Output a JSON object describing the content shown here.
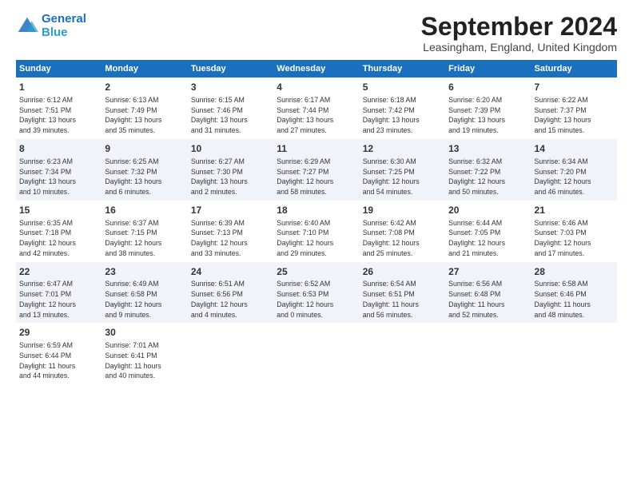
{
  "header": {
    "logo_line1": "General",
    "logo_line2": "Blue",
    "title": "September 2024",
    "location": "Leasingham, England, United Kingdom"
  },
  "columns": [
    "Sunday",
    "Monday",
    "Tuesday",
    "Wednesday",
    "Thursday",
    "Friday",
    "Saturday"
  ],
  "weeks": [
    [
      {
        "day": "1",
        "info": "Sunrise: 6:12 AM\nSunset: 7:51 PM\nDaylight: 13 hours\nand 39 minutes."
      },
      {
        "day": "2",
        "info": "Sunrise: 6:13 AM\nSunset: 7:49 PM\nDaylight: 13 hours\nand 35 minutes."
      },
      {
        "day": "3",
        "info": "Sunrise: 6:15 AM\nSunset: 7:46 PM\nDaylight: 13 hours\nand 31 minutes."
      },
      {
        "day": "4",
        "info": "Sunrise: 6:17 AM\nSunset: 7:44 PM\nDaylight: 13 hours\nand 27 minutes."
      },
      {
        "day": "5",
        "info": "Sunrise: 6:18 AM\nSunset: 7:42 PM\nDaylight: 13 hours\nand 23 minutes."
      },
      {
        "day": "6",
        "info": "Sunrise: 6:20 AM\nSunset: 7:39 PM\nDaylight: 13 hours\nand 19 minutes."
      },
      {
        "day": "7",
        "info": "Sunrise: 6:22 AM\nSunset: 7:37 PM\nDaylight: 13 hours\nand 15 minutes."
      }
    ],
    [
      {
        "day": "8",
        "info": "Sunrise: 6:23 AM\nSunset: 7:34 PM\nDaylight: 13 hours\nand 10 minutes."
      },
      {
        "day": "9",
        "info": "Sunrise: 6:25 AM\nSunset: 7:32 PM\nDaylight: 13 hours\nand 6 minutes."
      },
      {
        "day": "10",
        "info": "Sunrise: 6:27 AM\nSunset: 7:30 PM\nDaylight: 13 hours\nand 2 minutes."
      },
      {
        "day": "11",
        "info": "Sunrise: 6:29 AM\nSunset: 7:27 PM\nDaylight: 12 hours\nand 58 minutes."
      },
      {
        "day": "12",
        "info": "Sunrise: 6:30 AM\nSunset: 7:25 PM\nDaylight: 12 hours\nand 54 minutes."
      },
      {
        "day": "13",
        "info": "Sunrise: 6:32 AM\nSunset: 7:22 PM\nDaylight: 12 hours\nand 50 minutes."
      },
      {
        "day": "14",
        "info": "Sunrise: 6:34 AM\nSunset: 7:20 PM\nDaylight: 12 hours\nand 46 minutes."
      }
    ],
    [
      {
        "day": "15",
        "info": "Sunrise: 6:35 AM\nSunset: 7:18 PM\nDaylight: 12 hours\nand 42 minutes."
      },
      {
        "day": "16",
        "info": "Sunrise: 6:37 AM\nSunset: 7:15 PM\nDaylight: 12 hours\nand 38 minutes."
      },
      {
        "day": "17",
        "info": "Sunrise: 6:39 AM\nSunset: 7:13 PM\nDaylight: 12 hours\nand 33 minutes."
      },
      {
        "day": "18",
        "info": "Sunrise: 6:40 AM\nSunset: 7:10 PM\nDaylight: 12 hours\nand 29 minutes."
      },
      {
        "day": "19",
        "info": "Sunrise: 6:42 AM\nSunset: 7:08 PM\nDaylight: 12 hours\nand 25 minutes."
      },
      {
        "day": "20",
        "info": "Sunrise: 6:44 AM\nSunset: 7:05 PM\nDaylight: 12 hours\nand 21 minutes."
      },
      {
        "day": "21",
        "info": "Sunrise: 6:46 AM\nSunset: 7:03 PM\nDaylight: 12 hours\nand 17 minutes."
      }
    ],
    [
      {
        "day": "22",
        "info": "Sunrise: 6:47 AM\nSunset: 7:01 PM\nDaylight: 12 hours\nand 13 minutes."
      },
      {
        "day": "23",
        "info": "Sunrise: 6:49 AM\nSunset: 6:58 PM\nDaylight: 12 hours\nand 9 minutes."
      },
      {
        "day": "24",
        "info": "Sunrise: 6:51 AM\nSunset: 6:56 PM\nDaylight: 12 hours\nand 4 minutes."
      },
      {
        "day": "25",
        "info": "Sunrise: 6:52 AM\nSunset: 6:53 PM\nDaylight: 12 hours\nand 0 minutes."
      },
      {
        "day": "26",
        "info": "Sunrise: 6:54 AM\nSunset: 6:51 PM\nDaylight: 11 hours\nand 56 minutes."
      },
      {
        "day": "27",
        "info": "Sunrise: 6:56 AM\nSunset: 6:48 PM\nDaylight: 11 hours\nand 52 minutes."
      },
      {
        "day": "28",
        "info": "Sunrise: 6:58 AM\nSunset: 6:46 PM\nDaylight: 11 hours\nand 48 minutes."
      }
    ],
    [
      {
        "day": "29",
        "info": "Sunrise: 6:59 AM\nSunset: 6:44 PM\nDaylight: 11 hours\nand 44 minutes."
      },
      {
        "day": "30",
        "info": "Sunrise: 7:01 AM\nSunset: 6:41 PM\nDaylight: 11 hours\nand 40 minutes."
      },
      {
        "day": "",
        "info": ""
      },
      {
        "day": "",
        "info": ""
      },
      {
        "day": "",
        "info": ""
      },
      {
        "day": "",
        "info": ""
      },
      {
        "day": "",
        "info": ""
      }
    ]
  ]
}
